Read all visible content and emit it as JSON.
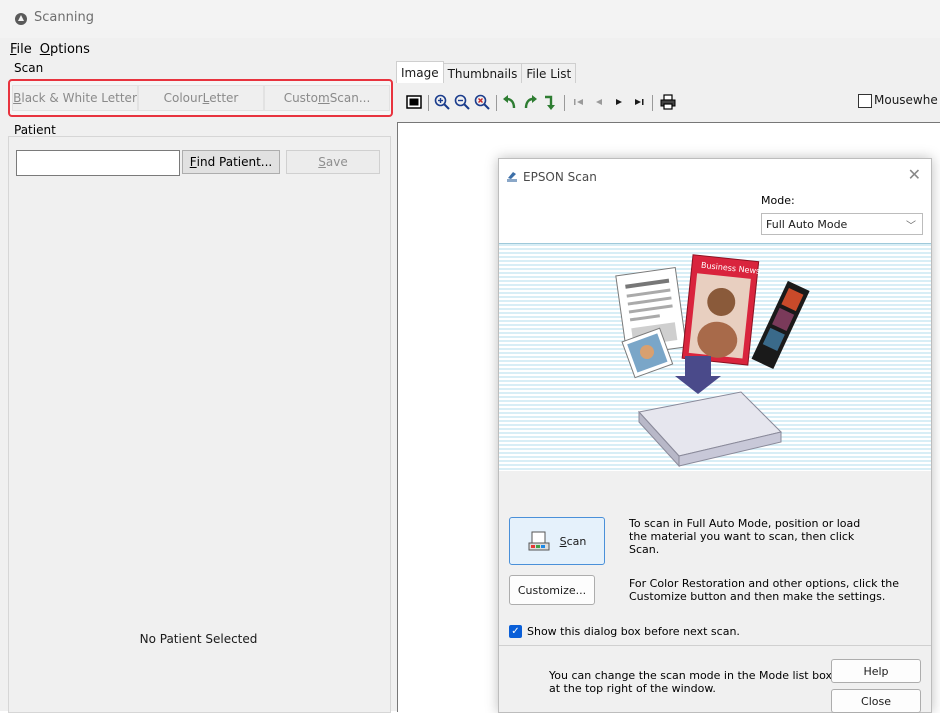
{
  "window": {
    "title": "Scanning",
    "menu": [
      {
        "label": "File",
        "accel": "F",
        "rest": "ile"
      },
      {
        "label": "Options",
        "accel": "O",
        "rest": "ptions"
      }
    ]
  },
  "scan": {
    "group_label": "Scan",
    "buttons": [
      {
        "pre": "",
        "accel": "B",
        "post": "lack & White Letter"
      },
      {
        "pre": "Colour ",
        "accel": "L",
        "post": "etter"
      },
      {
        "pre": "Custo",
        "accel": "m",
        "post": " Scan..."
      }
    ]
  },
  "patient": {
    "group_label": "Patient",
    "search_value": "",
    "find_accel": "F",
    "find_rest": "ind Patient...",
    "save_accel": "S",
    "save_rest": "ave",
    "status": "No Patient Selected"
  },
  "viewer": {
    "tabs": [
      "Image",
      "Thumbnails",
      "File List"
    ],
    "active_tab": "Image",
    "mousewheel_label": "Mousewhe"
  },
  "epson": {
    "title": "EPSON Scan",
    "mode_label": "Mode:",
    "mode_value": "Full Auto Mode",
    "scan_accel": "S",
    "scan_rest": "can",
    "scan_desc": [
      "To scan in Full Auto Mode, position or load",
      "the material you want to scan, then click",
      "Scan."
    ],
    "customize_label": "Customize...",
    "customize_desc": [
      "For Color Restoration and other options, click the",
      "Customize button and then make the settings."
    ],
    "show_dialog_label": "Show this dialog box before next scan.",
    "show_dialog_checked": true,
    "footer_note": [
      "You can change the scan mode in the Mode list box",
      "at the top right of the window."
    ],
    "help_label": "Help",
    "close_label": "Close",
    "illustration_magazine": "Business News"
  },
  "colors": {
    "highlight_border": "#e8333e",
    "accent_blue": "#0a5fd8"
  }
}
